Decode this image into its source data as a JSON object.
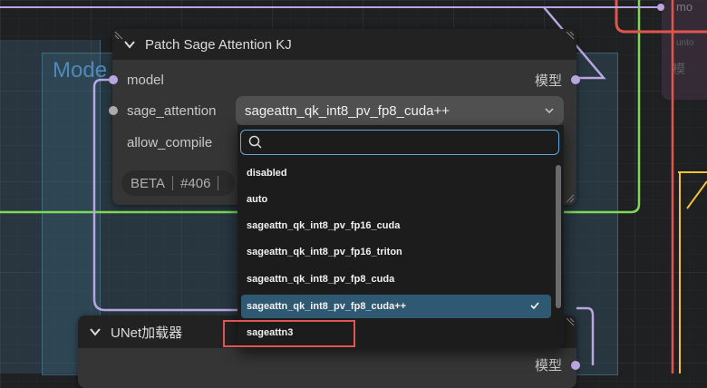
{
  "background_group": {
    "title": "Mode"
  },
  "right_node": {
    "top_label": "mo",
    "mid_label": "unto",
    "bot_label": "模"
  },
  "patch_node": {
    "title": "Patch Sage Attention KJ",
    "inputs": [
      "model",
      "sage_attention",
      "allow_compile"
    ],
    "output": "模型",
    "combo_value": "sageattn_qk_int8_pv_fp8_cuda++",
    "badges": [
      "BETA",
      "#406"
    ]
  },
  "dropdown": {
    "search_value": "",
    "options": [
      "disabled",
      "auto",
      "sageattn_qk_int8_pv_fp16_cuda",
      "sageattn_qk_int8_pv_fp16_triton",
      "sageattn_qk_int8_pv_fp8_cuda",
      "sageattn_qk_int8_pv_fp8_cuda++",
      "sageattn3"
    ],
    "selected_index": 5
  },
  "unet_node": {
    "title": "UNet加载器",
    "output": "模型"
  },
  "colors": {
    "accent": "#5da8dc",
    "selected_row": "#2f5873",
    "highlight_box": "#e25353",
    "wire_purple": "#b9a6e0",
    "wire_green": "#7ed957",
    "wire_red": "#e0564d",
    "wire_yellow": "#f2c230"
  },
  "icons": [
    "chevron-down-icon",
    "caret-down-icon",
    "search-icon",
    "check-icon",
    "resize-handle-icon"
  ]
}
